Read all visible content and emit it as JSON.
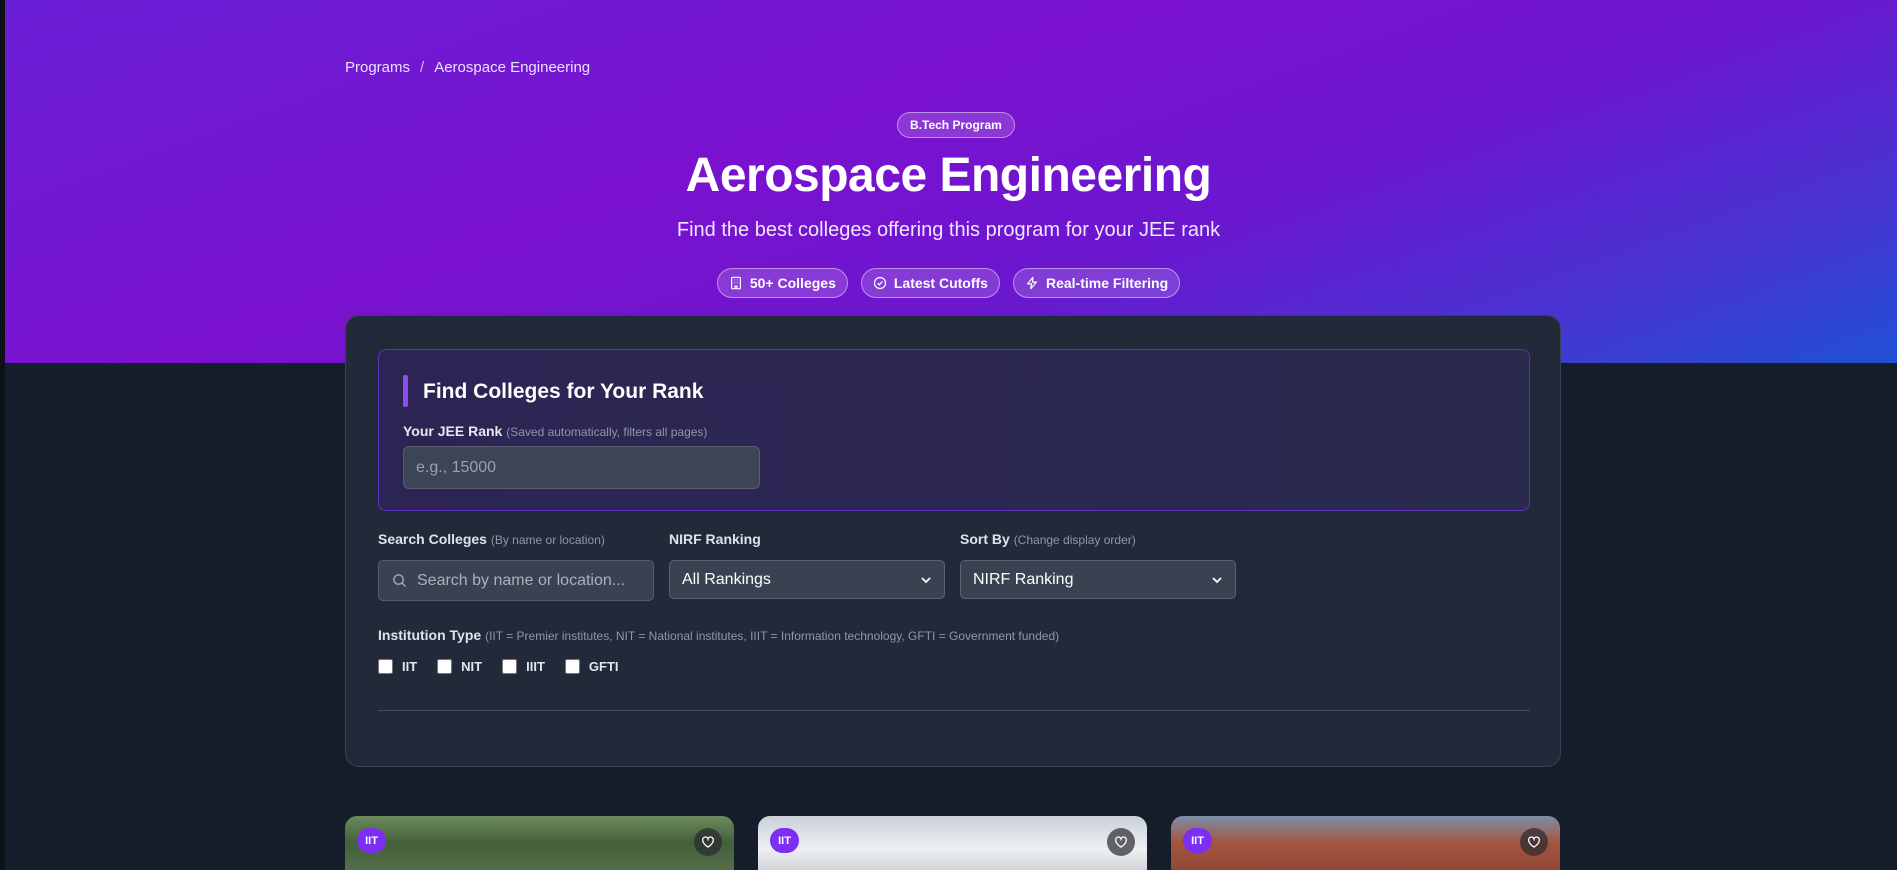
{
  "breadcrumb": {
    "root": "Programs",
    "separator": "/",
    "current": "Aerospace Engineering"
  },
  "hero": {
    "badge": "B.Tech Program",
    "title": "Aerospace Engineering",
    "subtitle": "Find the best colleges offering this program for your JEE rank",
    "features": [
      {
        "icon": "building-icon",
        "label": "50+ Colleges"
      },
      {
        "icon": "check-circle-icon",
        "label": "Latest Cutoffs"
      },
      {
        "icon": "lightning-icon",
        "label": "Real-time Filtering"
      }
    ]
  },
  "rank_finder": {
    "title": "Find Colleges for Your Rank",
    "label": "Your JEE Rank",
    "hint": "(Saved automatically, filters all pages)",
    "placeholder": "e.g., 15000",
    "value": ""
  },
  "filters": {
    "search": {
      "label": "Search Colleges",
      "hint": "(By name or location)",
      "placeholder": "Search by name or location...",
      "value": ""
    },
    "nirf": {
      "label": "NIRF Ranking",
      "selected": "All Rankings"
    },
    "sort": {
      "label": "Sort By",
      "hint": "(Change display order)",
      "selected": "NIRF Ranking"
    },
    "institution_type": {
      "label": "Institution Type",
      "hint": "(IIT = Premier institutes, NIT = National institutes, IIIT = Information technology, GFTI = Government funded)",
      "options": [
        "IIT",
        "NIT",
        "IIIT",
        "GFTI"
      ]
    }
  },
  "cards": [
    {
      "badge": "IIT",
      "favorite_icon": "heart-icon"
    },
    {
      "badge": "IIT",
      "favorite_icon": "heart-icon"
    },
    {
      "badge": "IIT",
      "favorite_icon": "heart-icon"
    }
  ],
  "colors": {
    "accent": "#7c2ff0",
    "panel_bg": "#222a39",
    "page_bg": "#151c2a"
  }
}
